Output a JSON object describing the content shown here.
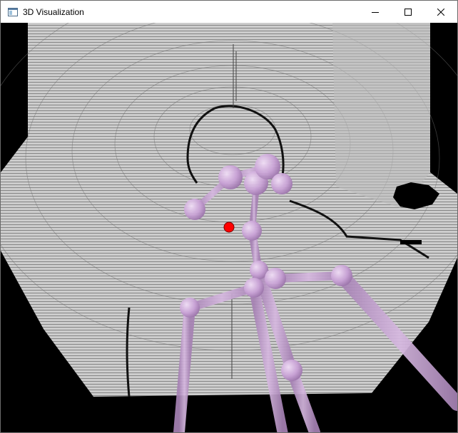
{
  "window": {
    "title": "3D Visualization",
    "icon": "app-window-icon",
    "controls": {
      "minimize_icon": "minimize-icon",
      "maximize_icon": "maximize-icon",
      "close_icon": "close-icon"
    }
  },
  "scene": {
    "background_color": "#000000",
    "point_cloud_color": "#dcdcdc",
    "skeleton_color": "#c9a3d6",
    "joint_highlight_color": "#ff0000"
  }
}
